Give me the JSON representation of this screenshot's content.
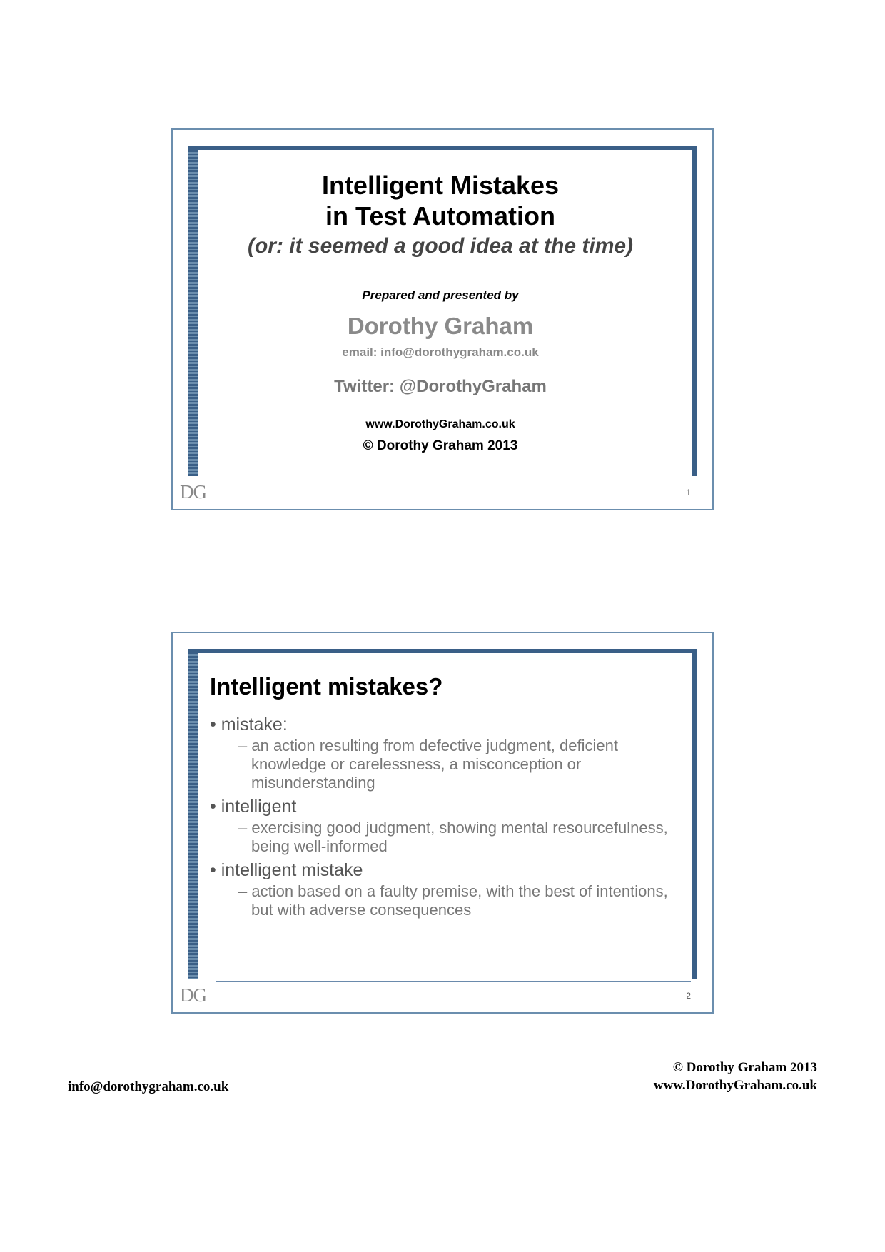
{
  "slide1": {
    "title_line1": "Intelligent Mistakes",
    "title_line2": "in Test Automation",
    "subtitle": "(or: it seemed a good idea at the time)",
    "prepared_by": "Prepared and presented by",
    "author": "Dorothy Graham",
    "email": "email: info@dorothygraham.co.uk",
    "twitter": "Twitter: @DorothyGraham",
    "website": "www.DorothyGraham.co.uk",
    "copyright": "© Dorothy Graham 2013",
    "logo": "DG",
    "number": "1"
  },
  "slide2": {
    "title": "Intelligent mistakes?",
    "b1": "mistake:",
    "b1_1": "an action resulting from defective judgment, deficient knowledge or carelessness, a misconception or misunderstanding",
    "b2": "intelligent",
    "b2_1": "exercising good judgment, showing mental resourcefulness, being well-informed",
    "b3": "intelligent mistake",
    "b3_1": "action based on a faulty premise, with the best of intentions, but with adverse consequences",
    "logo": "DG",
    "number": "2"
  },
  "footer": {
    "left": "info@dorothygraham.co.uk",
    "right1": "© Dorothy Graham 2013",
    "right2": "www.DorothyGraham.co.uk"
  }
}
